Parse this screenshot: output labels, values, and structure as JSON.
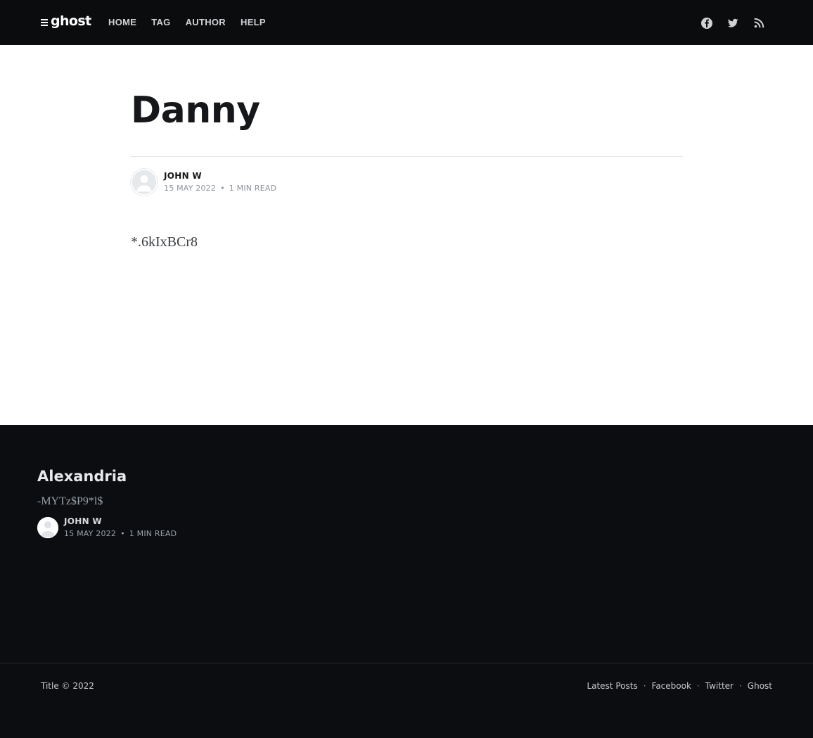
{
  "header": {
    "logo_text": "ghost",
    "nav": [
      {
        "label": "HOME"
      },
      {
        "label": "TAG"
      },
      {
        "label": "AUTHOR"
      },
      {
        "label": "HELP"
      }
    ],
    "social": [
      {
        "icon": "facebook-icon"
      },
      {
        "icon": "twitter-icon"
      },
      {
        "icon": "rss-icon"
      }
    ]
  },
  "post": {
    "title": "Danny",
    "author": "JOHN W",
    "date": "15 MAY 2022",
    "separator": "•",
    "read_time": "1 MIN READ",
    "content": "*.6kIxBCr8"
  },
  "related": {
    "title": "Alexandria",
    "excerpt": "-MYTz$P9*l$",
    "author": "JOHN W",
    "date": "15 MAY 2022",
    "separator": "•",
    "read_time": "1 MIN READ"
  },
  "footer": {
    "copyright": "Title © 2022",
    "links": [
      {
        "label": "Latest Posts"
      },
      {
        "label": "Facebook"
      },
      {
        "label": "Twitter"
      },
      {
        "label": "Ghost"
      }
    ],
    "link_separator": "·"
  },
  "colors": {
    "header_bg": "#0b0c0e",
    "footer_bg": "#0c0d10",
    "title": "#15171a",
    "meta": "#8c949c"
  }
}
